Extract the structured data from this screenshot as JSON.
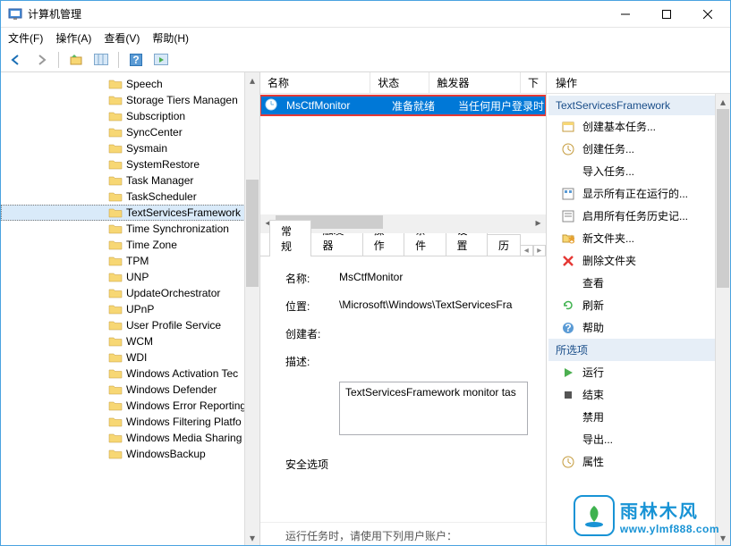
{
  "window": {
    "title": "计算机管理"
  },
  "menubar": [
    "文件(F)",
    "操作(A)",
    "查看(V)",
    "帮助(H)"
  ],
  "tree": {
    "items": [
      "Speech",
      "Storage Tiers Managen",
      "Subscription",
      "SyncCenter",
      "Sysmain",
      "SystemRestore",
      "Task Manager",
      "TaskScheduler",
      "TextServicesFramework",
      "Time Synchronization",
      "Time Zone",
      "TPM",
      "UNP",
      "UpdateOrchestrator",
      "UPnP",
      "User Profile Service",
      "WCM",
      "WDI",
      "Windows Activation Tec",
      "Windows Defender",
      "Windows Error Reporting",
      "Windows Filtering Platfo",
      "Windows Media Sharing",
      "WindowsBackup"
    ],
    "selected_index": 8
  },
  "list": {
    "headers": [
      "名称",
      "状态",
      "触发器",
      "下"
    ],
    "header_widths": [
      140,
      74,
      115,
      20
    ],
    "row": {
      "icon": "clock-icon",
      "cols": [
        "MsCtfMonitor",
        "准备就绪",
        "当任何用户登录时"
      ]
    }
  },
  "detail": {
    "tabs": [
      "常规",
      "触发器",
      "操作",
      "条件",
      "设置",
      "历"
    ],
    "active_tab": 0,
    "name_label": "名称:",
    "name_value": "MsCtfMonitor",
    "location_label": "位置:",
    "location_value": "\\Microsoft\\Windows\\TextServicesFra",
    "creator_label": "创建者:",
    "creator_value": "",
    "desc_label": "描述:",
    "desc_value": "TextServicesFramework monitor tas",
    "sec_label": "安全选项",
    "run_text": "运行任务时，请使用下列用户账户："
  },
  "actions": {
    "title": "操作",
    "section1_title": "TextServicesFramework",
    "section1_items": [
      {
        "icon": "create-basic-icon",
        "label": "创建基本任务..."
      },
      {
        "icon": "create-task-icon",
        "label": "创建任务..."
      },
      {
        "icon": "import-icon",
        "label": "导入任务..."
      },
      {
        "icon": "show-running-icon",
        "label": "显示所有正在运行的..."
      },
      {
        "icon": "enable-history-icon",
        "label": "启用所有任务历史记..."
      },
      {
        "icon": "new-folder-icon",
        "label": "新文件夹..."
      },
      {
        "icon": "delete-folder-icon",
        "label": "删除文件夹"
      },
      {
        "icon": "view-icon",
        "label": "查看",
        "has_submenu": true
      },
      {
        "icon": "refresh-icon",
        "label": "刷新"
      },
      {
        "icon": "help-icon",
        "label": "帮助"
      }
    ],
    "section2_title": "所选项",
    "section2_items": [
      {
        "icon": "run-icon",
        "label": "运行"
      },
      {
        "icon": "end-icon",
        "label": "结束"
      },
      {
        "icon": "disable-icon",
        "label": "禁用"
      },
      {
        "icon": "export-icon",
        "label": "导出..."
      },
      {
        "icon": "props-icon",
        "label": "属性"
      }
    ]
  },
  "watermark": {
    "brand": "雨林木风",
    "domain": "www.ylmf888.com"
  }
}
